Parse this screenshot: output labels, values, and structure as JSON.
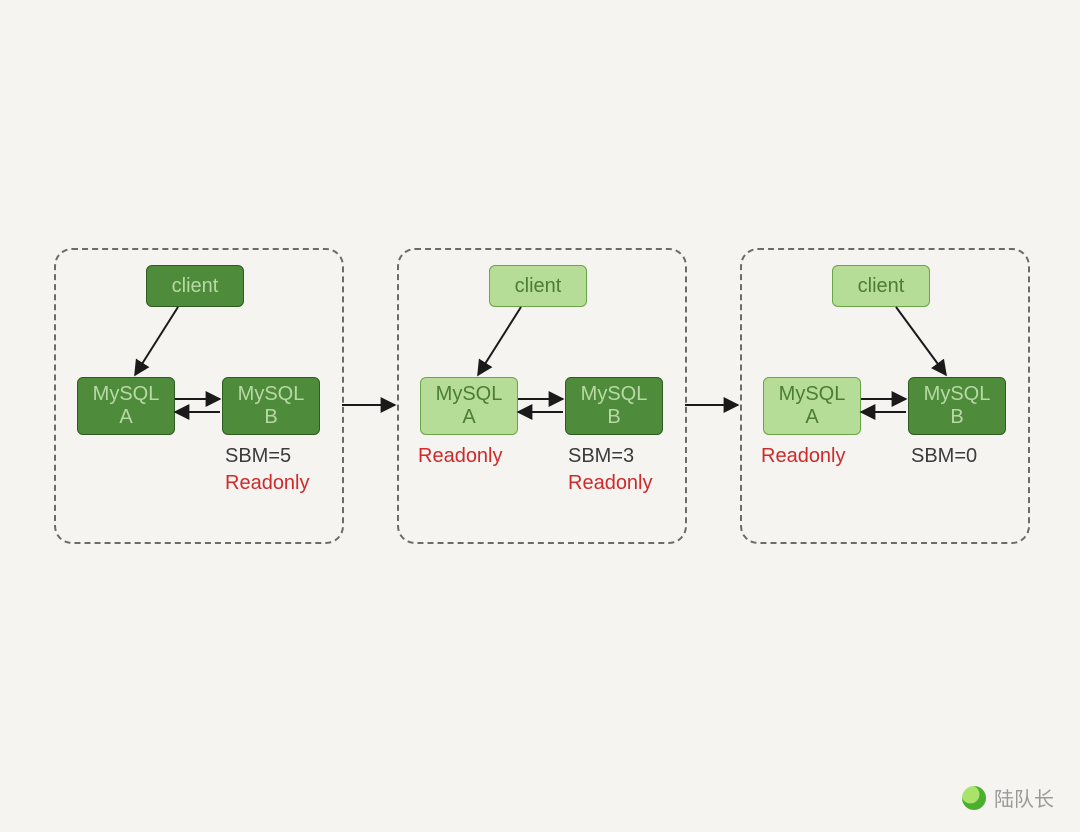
{
  "watermark": {
    "text": "陆队长"
  },
  "panels": [
    {
      "client_label": "client",
      "mysql_a_label": "MySQL\nA",
      "mysql_b_label": "MySQL\nB",
      "sbm_label": "SBM=5",
      "readonly_label_a": "",
      "readonly_label_b": "Readonly",
      "client_style": "dark",
      "mysql_a_style": "dark",
      "mysql_b_style": "dark"
    },
    {
      "client_label": "client",
      "mysql_a_label": "MySQL\nA",
      "mysql_b_label": "MySQL\nB",
      "sbm_label": "SBM=3",
      "readonly_label_a": "Readonly",
      "readonly_label_b": "Readonly",
      "client_style": "light",
      "mysql_a_style": "light",
      "mysql_b_style": "dark"
    },
    {
      "client_label": "client",
      "mysql_a_label": "MySQL\nA",
      "mysql_b_label": "MySQL\nB",
      "sbm_label": "SBM=0",
      "readonly_label_a": "Readonly",
      "readonly_label_b": "",
      "client_style": "light",
      "mysql_a_style": "light",
      "mysql_b_style": "dark"
    }
  ]
}
